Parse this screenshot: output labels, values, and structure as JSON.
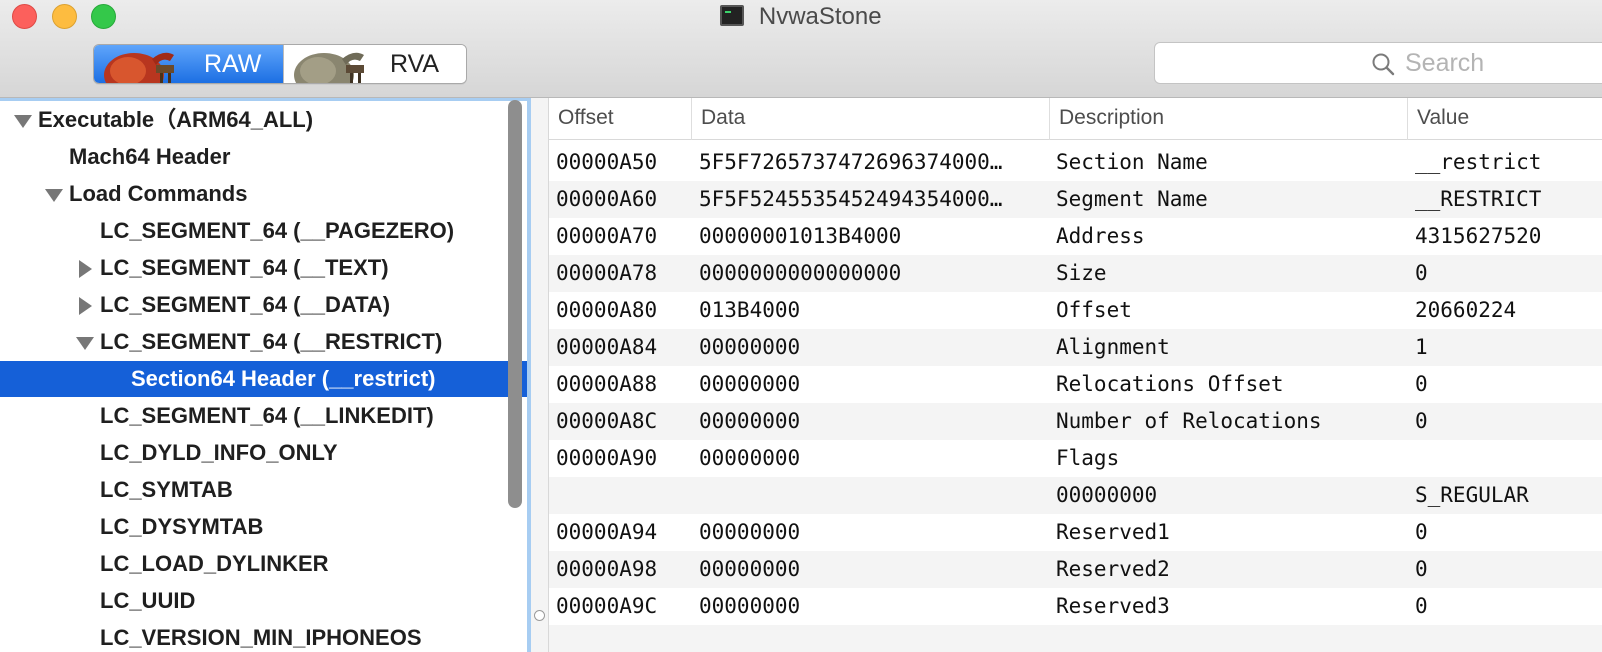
{
  "window": {
    "title": "NvwaStone"
  },
  "toolbar": {
    "segments": [
      {
        "label": "RAW",
        "selected": true
      },
      {
        "label": "RVA",
        "selected": false
      }
    ],
    "search_placeholder": "Search",
    "accent_color": "#1c6fe3"
  },
  "sidebar": {
    "items": [
      {
        "label": "Executable（ARM64_ALL)",
        "expander": "down",
        "level": 0,
        "selected": false
      },
      {
        "label": "Mach64 Header",
        "expander": "none",
        "level": 1,
        "selected": false
      },
      {
        "label": "Load Commands",
        "expander": "down",
        "level": 1,
        "selected": false
      },
      {
        "label": "LC_SEGMENT_64 (__PAGEZERO)",
        "expander": "none",
        "level": 2,
        "selected": false
      },
      {
        "label": "LC_SEGMENT_64 (__TEXT)",
        "expander": "right",
        "level": 2,
        "selected": false
      },
      {
        "label": "LC_SEGMENT_64 (__DATA)",
        "expander": "right",
        "level": 2,
        "selected": false
      },
      {
        "label": "LC_SEGMENT_64 (__RESTRICT)",
        "expander": "down",
        "level": 2,
        "selected": false
      },
      {
        "label": "Section64 Header (__restrict)",
        "expander": "none",
        "level": 3,
        "selected": true
      },
      {
        "label": "LC_SEGMENT_64 (__LINKEDIT)",
        "expander": "none",
        "level": 2,
        "selected": false
      },
      {
        "label": "LC_DYLD_INFO_ONLY",
        "expander": "none",
        "level": 2,
        "selected": false
      },
      {
        "label": "LC_SYMTAB",
        "expander": "none",
        "level": 2,
        "selected": false
      },
      {
        "label": "LC_DYSYMTAB",
        "expander": "none",
        "level": 2,
        "selected": false
      },
      {
        "label": "LC_LOAD_DYLINKER",
        "expander": "none",
        "level": 2,
        "selected": false
      },
      {
        "label": "LC_UUID",
        "expander": "none",
        "level": 2,
        "selected": false
      },
      {
        "label": "LC_VERSION_MIN_IPHONEOS",
        "expander": "none",
        "level": 2,
        "selected": false
      }
    ]
  },
  "table": {
    "columns": [
      "Offset",
      "Data",
      "Description",
      "Value"
    ],
    "rows": [
      {
        "offset": "00000A50",
        "data": "5F5F7265737472696374000…",
        "description": "Section Name",
        "value": "__restrict"
      },
      {
        "offset": "00000A60",
        "data": "5F5F5245535452494354000…",
        "description": "Segment Name",
        "value": "__RESTRICT"
      },
      {
        "offset": "00000A70",
        "data": "00000001013B4000",
        "description": "Address",
        "value": "4315627520"
      },
      {
        "offset": "00000A78",
        "data": "0000000000000000",
        "description": "Size",
        "value": "0"
      },
      {
        "offset": "00000A80",
        "data": "013B4000",
        "description": "Offset",
        "value": "20660224"
      },
      {
        "offset": "00000A84",
        "data": "00000000",
        "description": "Alignment",
        "value": "1"
      },
      {
        "offset": "00000A88",
        "data": "00000000",
        "description": "Relocations Offset",
        "value": "0"
      },
      {
        "offset": "00000A8C",
        "data": "00000000",
        "description": "Number of Relocations",
        "value": "0"
      },
      {
        "offset": "00000A90",
        "data": "00000000",
        "description": "Flags",
        "value": ""
      },
      {
        "offset": "",
        "data": "",
        "description": "00000000",
        "value": "S_REGULAR"
      },
      {
        "offset": "00000A94",
        "data": "00000000",
        "description": "Reserved1",
        "value": "0"
      },
      {
        "offset": "00000A98",
        "data": "00000000",
        "description": "Reserved2",
        "value": "0"
      },
      {
        "offset": "00000A9C",
        "data": "00000000",
        "description": "Reserved3",
        "value": "0"
      }
    ]
  }
}
